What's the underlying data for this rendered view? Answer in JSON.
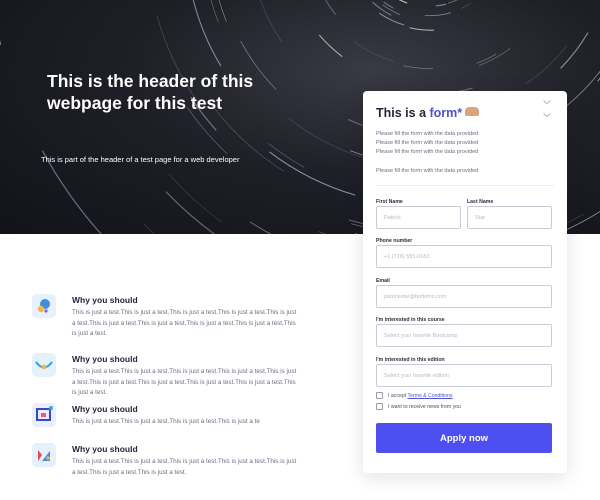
{
  "hero": {
    "title": "This is the header of this webpage for this test",
    "subtitle": "This is part of the header of a test page for a web developer"
  },
  "features": [
    {
      "title": "Why you should",
      "icon": "search-bubble-icon",
      "text": "This is just a test.This is just a test.This is just a test.This is just a test.This is just a test.This is just a test.This is just a test.This is just a test.This is just a test.This is just a test."
    },
    {
      "title": "Why you should",
      "icon": "arch-icon",
      "text": "This is just a test.This is just a test.This is just a test.This is just a test.This is just a test.This is just a test.This is just a test.This is just a test.This is just a test.This is just a test."
    },
    {
      "title": "Why you should",
      "icon": "monitor-icon",
      "text": "This is just a test.This is just a test.This is just a test.This is just a te"
    },
    {
      "title": "Why you should",
      "icon": "chart-card-icon",
      "text": "This is just a test.This is just a test.This is just a test.This is just a test.This is just a test.This is just a test.This is just a test."
    }
  ],
  "form": {
    "title_prefix": "This is a ",
    "title_accent": "form*",
    "info": [
      "Please fill the form with the data provided",
      "Please fill the form with the data provided",
      "Please fill the form with the data provided",
      "Please fill the form with the data provided"
    ],
    "first_name": {
      "label": "First Name",
      "placeholder": "Patrick"
    },
    "last_name": {
      "label": "Last Name",
      "placeholder": "Star"
    },
    "phone": {
      "label": "Phone number",
      "placeholder": "+1 (716) 555-0182"
    },
    "email": {
      "label": "Email",
      "placeholder": "patrickstar@bottoms.com"
    },
    "course": {
      "label": "I'm interested in this course",
      "placeholder": "Select your favorite Bootcamp"
    },
    "edition": {
      "label": "I'm interested in this edition",
      "placeholder": "Select your favorite edition"
    },
    "accept_prefix": "I accept ",
    "accept_link": "Terms & Conditions",
    "news_label": "I want to receive news from you",
    "apply_label": "Apply now"
  },
  "colors": {
    "accent": "#4d4ff0",
    "hero_bg": "#1b1b22"
  }
}
